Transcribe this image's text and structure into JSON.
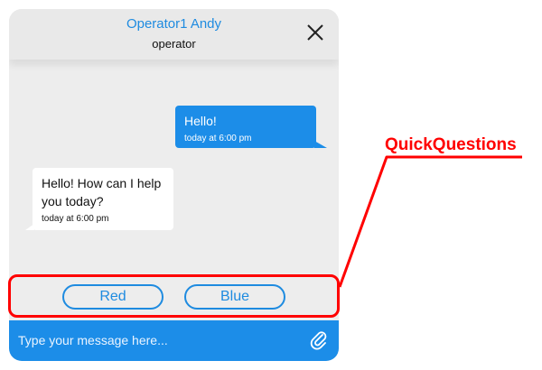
{
  "header": {
    "operator_name": "Operator1 Andy",
    "operator_role": "operator"
  },
  "messages": [
    {
      "direction": "outgoing",
      "text": "Hello!",
      "time": "today at 6:00 pm"
    },
    {
      "direction": "incoming",
      "text": "Hello! How can I help you today?",
      "time": "today at 6:00 pm"
    }
  ],
  "quick_questions": [
    {
      "label": "Red"
    },
    {
      "label": "Blue"
    }
  ],
  "composer": {
    "placeholder": "Type your message here..."
  },
  "annotation": {
    "label": "QuickQuestions"
  },
  "colors": {
    "accent": "#1c8de8",
    "annotation": "#ff0000",
    "panel": "#ededed"
  },
  "icons": {
    "close": "close-icon",
    "attach": "paperclip-icon"
  }
}
